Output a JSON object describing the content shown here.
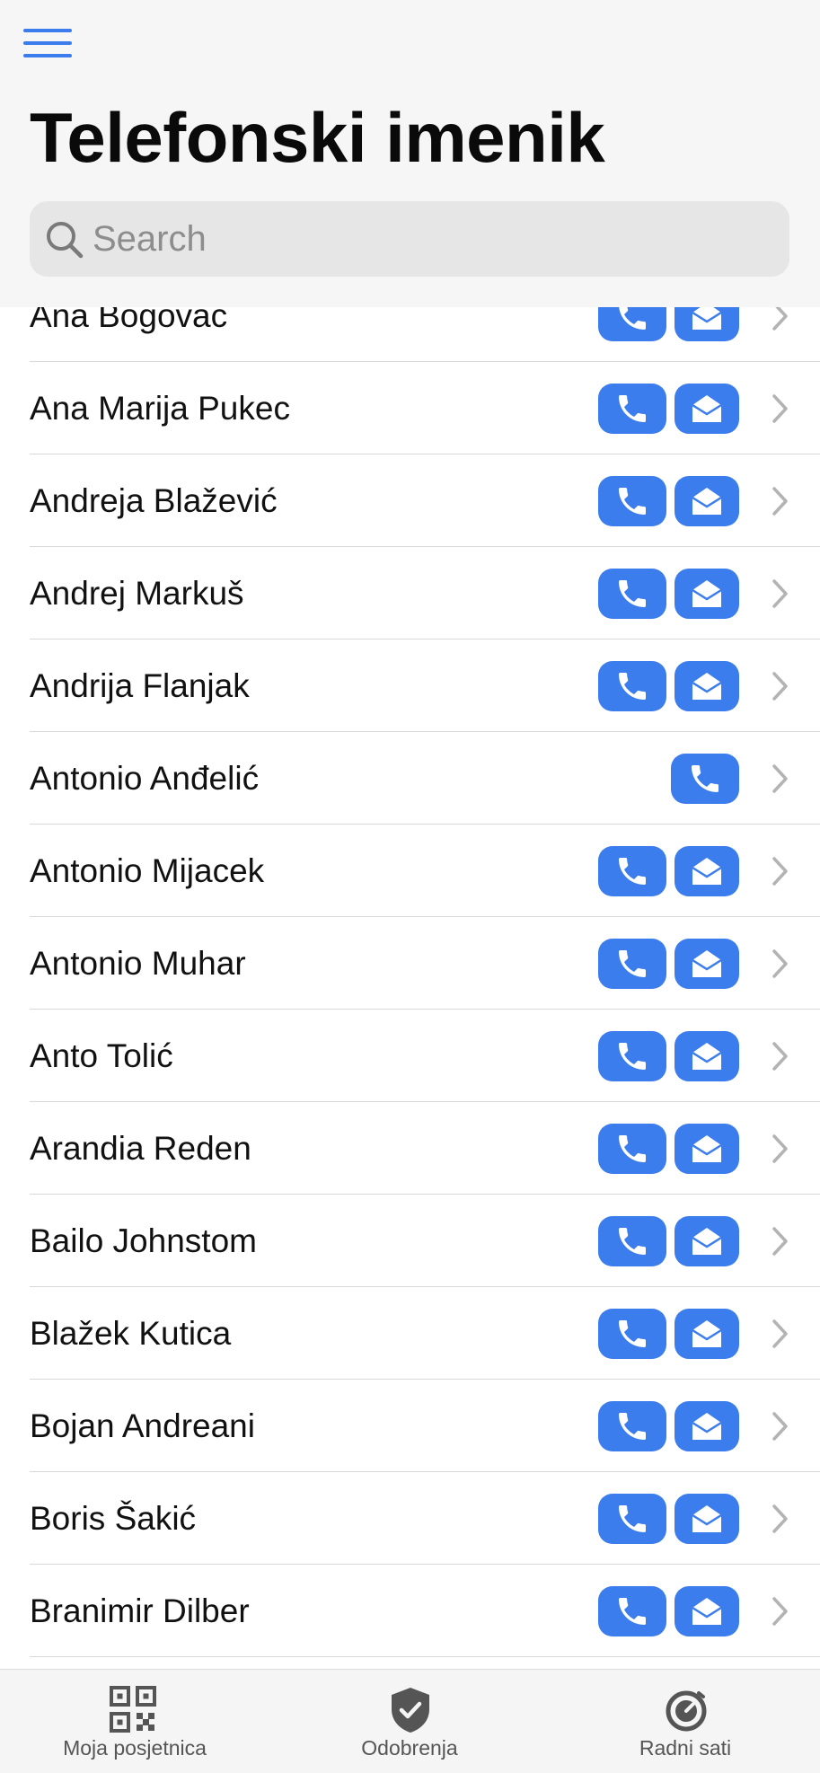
{
  "header": {
    "title": "Telefonski imenik",
    "search_placeholder": "Search"
  },
  "contacts": [
    {
      "name": "Ana Bogovac",
      "has_call": true,
      "has_mail": true
    },
    {
      "name": "Ana Marija Pukec",
      "has_call": true,
      "has_mail": true
    },
    {
      "name": "Andreja Blažević",
      "has_call": true,
      "has_mail": true
    },
    {
      "name": "Andrej Markuš",
      "has_call": true,
      "has_mail": true
    },
    {
      "name": "Andrija Flanjak",
      "has_call": true,
      "has_mail": true
    },
    {
      "name": "Antonio Anđelić",
      "has_call": true,
      "has_mail": false
    },
    {
      "name": "Antonio Mijacek",
      "has_call": true,
      "has_mail": true
    },
    {
      "name": "Antonio Muhar",
      "has_call": true,
      "has_mail": true
    },
    {
      "name": "Anto Tolić",
      "has_call": true,
      "has_mail": true
    },
    {
      "name": "Arandia Reden",
      "has_call": true,
      "has_mail": true
    },
    {
      "name": "Bailo Johnstom",
      "has_call": true,
      "has_mail": true
    },
    {
      "name": "Blažek Kutica",
      "has_call": true,
      "has_mail": true
    },
    {
      "name": "Bojan Andreani",
      "has_call": true,
      "has_mail": true
    },
    {
      "name": "Boris Šakić",
      "has_call": true,
      "has_mail": true
    },
    {
      "name": "Branimir Dilber",
      "has_call": true,
      "has_mail": true
    },
    {
      "name": "",
      "has_call": false,
      "has_mail": false
    }
  ],
  "tabbar": {
    "tabs": [
      {
        "label": "Moja posjetnica",
        "icon": "qr-code-icon"
      },
      {
        "label": "Odobrenja",
        "icon": "shield-check-icon"
      },
      {
        "label": "Radni sati",
        "icon": "clock-icon"
      }
    ]
  },
  "colors": {
    "accent": "#3b7ded",
    "header_bg": "#f6f6f6",
    "tab_label": "#555555"
  }
}
